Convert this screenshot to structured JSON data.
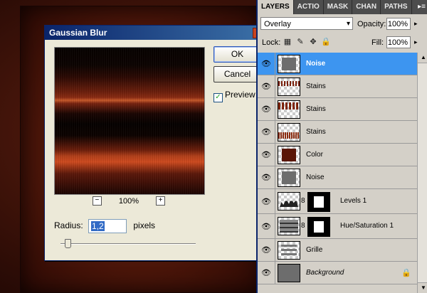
{
  "dialog": {
    "title": "Gaussian Blur",
    "ok_label": "OK",
    "cancel_label": "Cancel",
    "preview_label": "Preview",
    "preview_checked": "✓",
    "zoom_minus": "−",
    "zoom_plus": "+",
    "zoom_value": "100%",
    "radius_label": "Radius:",
    "radius_value": "1,2",
    "radius_unit": "pixels"
  },
  "panel": {
    "tabs": [
      "LAYERS",
      "ACTIO",
      "MASK",
      "CHAN",
      "PATHS"
    ],
    "menu_icon": "▸≡",
    "blend_mode": "Overlay",
    "opacity_label": "Opacity:",
    "opacity_value": "100%",
    "lock_label": "Lock:",
    "fill_label": "Fill:",
    "fill_value": "100%",
    "arrow_icon": "▸",
    "lock_icons": [
      "▦",
      "✎",
      "✥",
      "🔒"
    ],
    "visibility_icon": "👁",
    "chain_icon": "8",
    "bg_lock_icon": "🔒",
    "scroll_up": "▲",
    "scroll_down": "▼"
  },
  "layers": [
    {
      "name": "Noise",
      "selected": true
    },
    {
      "name": "Stains"
    },
    {
      "name": "Stains"
    },
    {
      "name": "Stains"
    },
    {
      "name": "Color"
    },
    {
      "name": "Noise"
    },
    {
      "name": "Levels 1"
    },
    {
      "name": "Hue/Saturation 1"
    },
    {
      "name": "Grille"
    },
    {
      "name": "Background"
    }
  ],
  "colors": {
    "selected_row": "#3d95f0",
    "title_bar": "#0a246a"
  }
}
